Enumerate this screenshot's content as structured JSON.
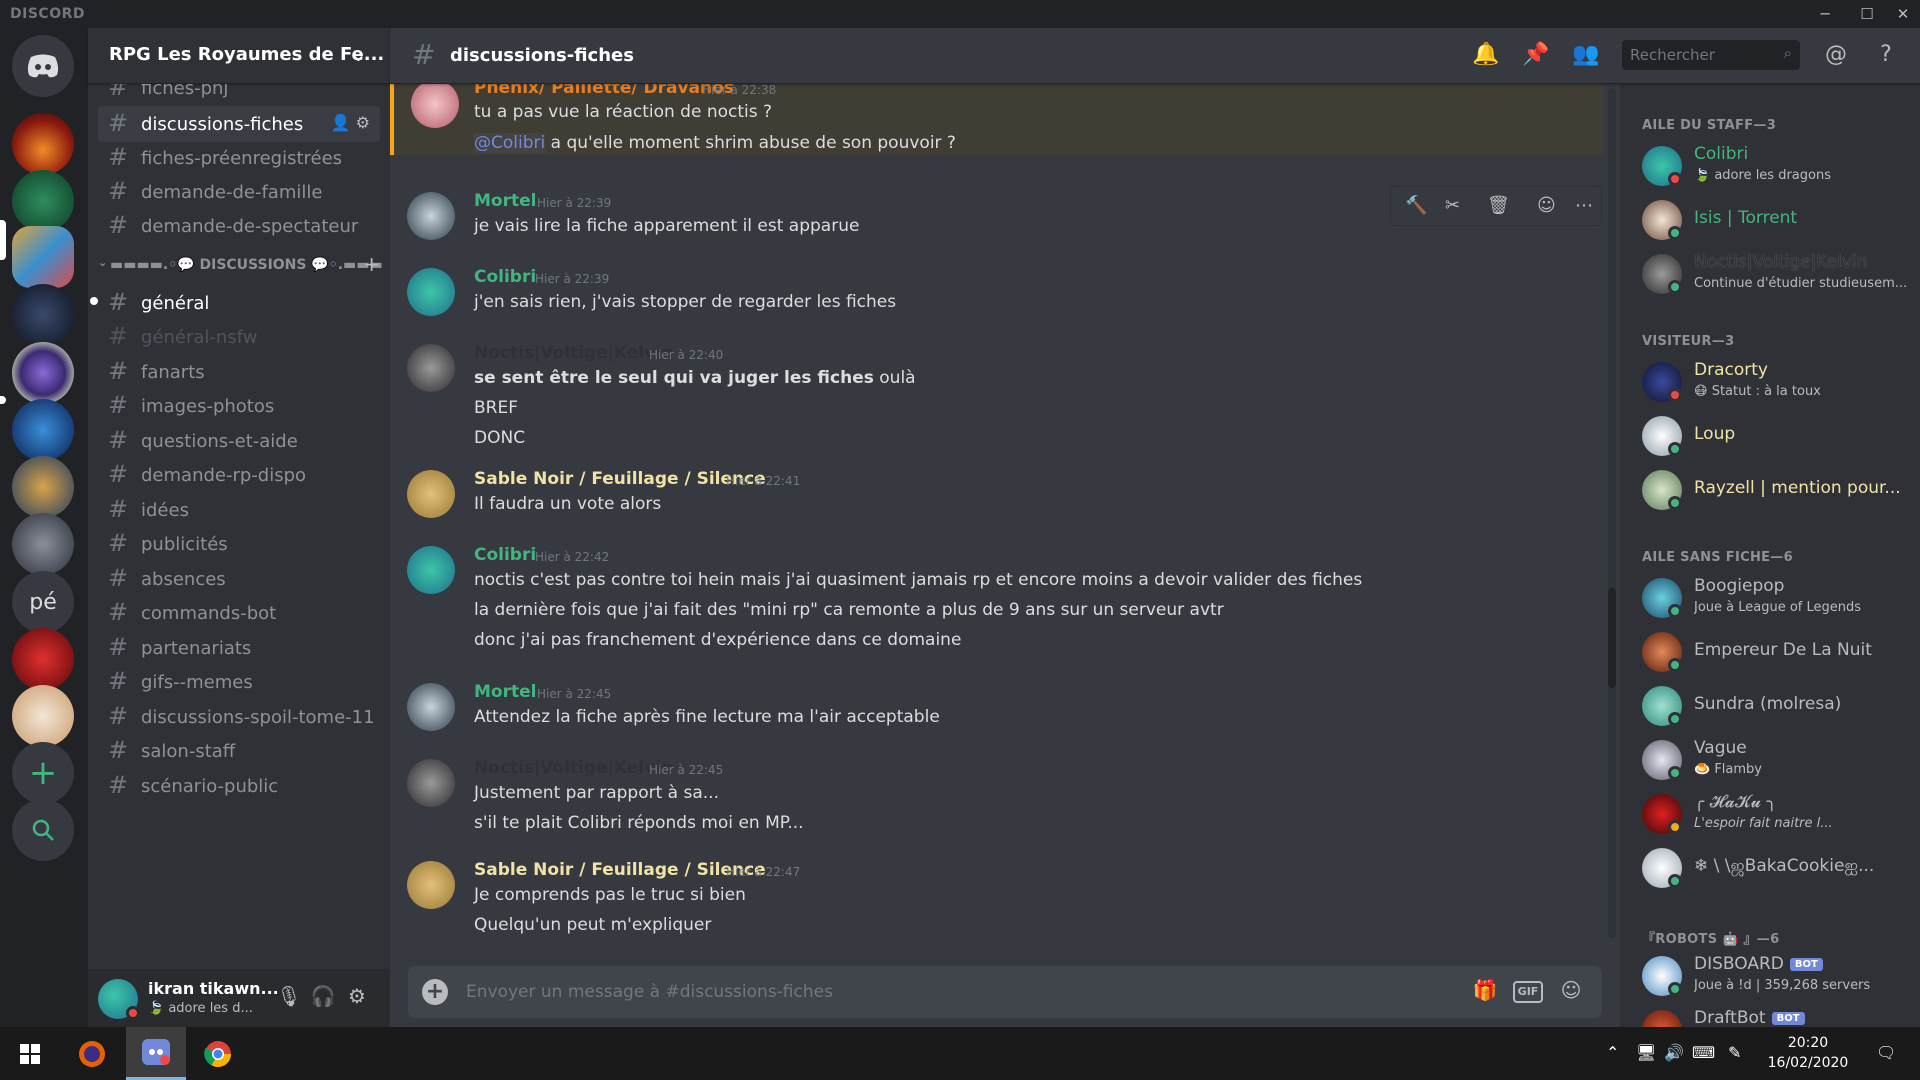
{
  "app": {
    "brand": "DISCORD"
  },
  "server": {
    "name": "RPG Les Royaumes de Fe..."
  },
  "channels_top": [
    {
      "name": "fiches-pnj"
    },
    {
      "name": "discussions-fiches"
    },
    {
      "name": "fiches-préenregistrées"
    },
    {
      "name": "demande-de-famille"
    },
    {
      "name": "demande-de-spectateur"
    }
  ],
  "category": {
    "label": "▬▬▬▬.◦💬 DISCUSSIONS 💬◦.▬▬▬"
  },
  "channels_discussion": [
    {
      "name": "général"
    },
    {
      "name": "général-nsfw"
    },
    {
      "name": "fanarts"
    },
    {
      "name": "images-photos"
    },
    {
      "name": "questions-et-aide"
    },
    {
      "name": "demande-rp-dispo"
    },
    {
      "name": "idées"
    },
    {
      "name": "publicités"
    },
    {
      "name": "absences"
    },
    {
      "name": "commands-bot"
    },
    {
      "name": "partenariats"
    },
    {
      "name": "gifs--memes"
    },
    {
      "name": "discussions-spoil-tome-11"
    },
    {
      "name": "salon-staff"
    },
    {
      "name": "scénario-public"
    }
  ],
  "user": {
    "name": "ikran tikawn...",
    "status": "adore les d..."
  },
  "header": {
    "channel": "discussions-fiches",
    "search_placeholder": "Rechercher"
  },
  "messages": [
    {
      "author": "Phenix/ Paillette/ Dravanos",
      "time": "Hier à 22:38",
      "lines": [
        "tu a pas vue la réaction de noctis ?"
      ],
      "mention": "@Colibri",
      "mention_rest": " a qu'elle moment shrim abuse de son pouvoir ?"
    },
    {
      "author": "Mortel",
      "time": "Hier à 22:39",
      "lines": [
        "je vais lire la fiche apparement il est apparue"
      ]
    },
    {
      "author": "Colibri",
      "time": "Hier à 22:39",
      "lines": [
        "j'en sais rien, j'vais stopper de regarder les fiches"
      ]
    },
    {
      "author": "Noctis|Voltige|Kelvin",
      "time": "Hier à 22:40",
      "bold": "se sent être le seul qui va juger les fiches",
      "bold_rest": " oulà",
      "lines": [
        "BREF",
        "DONC"
      ]
    },
    {
      "author": "Sable Noir / Feuillage / Silence",
      "time": "Hier à 22:41",
      "lines": [
        "Il faudra un vote alors"
      ]
    },
    {
      "author": "Colibri",
      "time": "Hier à 22:42",
      "lines": [
        "noctis c'est pas contre toi hein mais j'ai quasiment jamais rp et encore moins a devoir valider des fiches",
        "la dernière fois que j'ai fait des \"mini rp\" ca remonte a plus de 9 ans sur un serveur avtr",
        "donc j'ai pas franchement d'expérience dans ce domaine"
      ]
    },
    {
      "author": "Mortel",
      "time": "Hier à 22:45",
      "lines": [
        "Attendez la fiche après fine lecture ma l'air acceptable"
      ]
    },
    {
      "author": "Noctis|Voltige|Kelvin",
      "time": "Hier à 22:45",
      "lines": [
        "Justement par rapport à sa...",
        "s'il te plait Colibri réponds moi en MP..."
      ]
    },
    {
      "author": "Sable Noir / Feuillage / Silence",
      "time": "Hier à 22:47",
      "lines": [
        "Je comprends pas le truc si bien",
        "Quelqu'un peut m'expliquer"
      ]
    }
  ],
  "composer": {
    "placeholder": "Envoyer un message à #discussions-fiches",
    "gif": "GIF"
  },
  "members": {
    "groups": [
      {
        "label": "AILE DU STAFF—3"
      },
      {
        "label": "VISITEUR—3"
      },
      {
        "label": "AILE SANS FICHE—6"
      },
      {
        "label": "『ROBOTS 🤖 』—6"
      }
    ],
    "list": [
      {
        "name": "Colibri",
        "status": "adore les dragons"
      },
      {
        "name": "Isis | Torrent",
        "status": ""
      },
      {
        "name": "Noctis|Voltige|Kelvin",
        "status": "Continue d'étudier studieusem..."
      },
      {
        "name": "Dracorty",
        "status": "Statut : à la toux"
      },
      {
        "name": "Loup",
        "status": ""
      },
      {
        "name": "Rayzell | mention pour...",
        "status": ""
      },
      {
        "name": "Boogiepop",
        "status": "Joue à League of Legends"
      },
      {
        "name": "Empereur De La Nuit",
        "status": ""
      },
      {
        "name": "Sundra (molresa)",
        "status": ""
      },
      {
        "name": "Vague",
        "status": "Flamby"
      },
      {
        "name": "╭ 𝓗𝓪𝓚𝓾 ╮",
        "status": "L'espoir fait naitre l..."
      },
      {
        "name": "❄ \\ \\ஜBakaCookieஐ...",
        "status": ""
      },
      {
        "name": "DISBOARD",
        "status": "Joue à !d | 359,268 servers",
        "bot": "BOT"
      },
      {
        "name": "DraftBot",
        "status": "",
        "bot": "BOT"
      }
    ]
  },
  "taskbar": {
    "time": "20:20",
    "date": "16/02/2020"
  },
  "colors": {
    "accent": "#7289da",
    "online": "#43b581",
    "dnd": "#f04747",
    "idle": "#faa61a"
  }
}
